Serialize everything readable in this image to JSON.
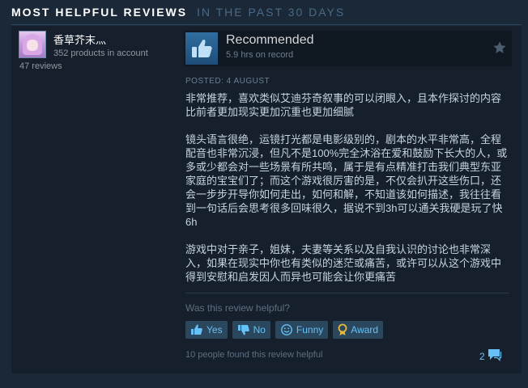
{
  "section": {
    "title": "MOST HELPFUL REVIEWS",
    "subtitle": "IN THE PAST 30 DAYS"
  },
  "author": {
    "name": "香草芥末灬",
    "products": "352 products in account",
    "reviews": "47 reviews"
  },
  "review": {
    "recommendation": "Recommended",
    "hours": "5.9 hrs on record",
    "posted": "POSTED: 4 AUGUST",
    "paragraphs": [
      "非常推荐，喜欢类似艾迪芬奇叙事的可以闭眼入，且本作探讨的内容比前者更加现实更加沉重也更加细腻",
      "镜头语言很绝，运镜打光都是电影级别的，剧本的水平非常高，全程配音也非常沉浸，但凡不是100%完全沐浴在爱和鼓励下长大的人，或多或少都会对一些场景有所共鸣，属于是有点精准打击我们典型东亚家庭的宝宝们了；而这个游戏很厉害的是，不仅会扒开这些伤口，还会一步步开导你如何走出，如何和解，不知道该如何描述，我往往看到一句话后会思考很多回味很久，据说不到3h可以通关我硬是玩了快6h",
      "游戏中对于亲子，姐妹，夫妻等关系以及自我认识的讨论也非常深入，如果在现实中你也有类似的迷茫或痛苦，或许可以从这个游戏中得到安慰和启发因人而异也可能会让你更痛苦"
    ]
  },
  "helpful": {
    "question": "Was this review helpful?",
    "buttons": {
      "yes": "Yes",
      "no": "No",
      "funny": "Funny",
      "award": "Award"
    },
    "found": "10 people found this review helpful",
    "comment_count": "2"
  },
  "colors": {
    "background": "#1b2838",
    "review_bg": "#16202d",
    "accent": "#67c1f5",
    "button_bg": "#2a475e",
    "award_gold": "#e8b83a"
  },
  "icons": [
    "thumbs-up-icon",
    "star-icon",
    "thumbs-down-icon",
    "smiley-icon",
    "award-icon",
    "comment-icon"
  ]
}
